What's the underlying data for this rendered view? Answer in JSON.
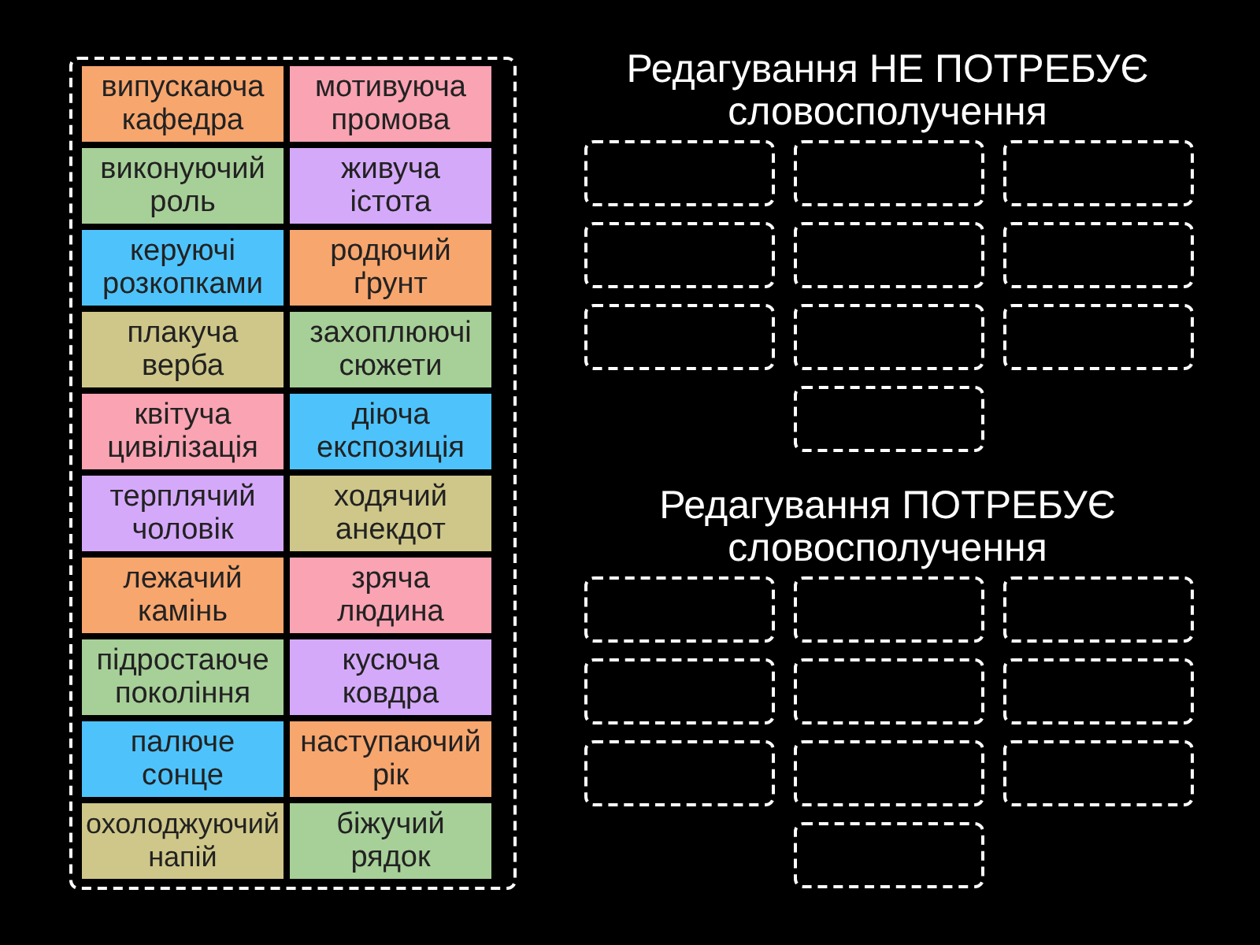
{
  "tiles": [
    {
      "text": "випускаюча кафедра",
      "color": "#f7a66e"
    },
    {
      "text": "мотивуюча промова",
      "color": "#f9a3b3"
    },
    {
      "text": "виконуючий роль",
      "color": "#a7cf98"
    },
    {
      "text": "живуча істота",
      "color": "#d5a9fa"
    },
    {
      "text": "керуючі розкопками",
      "color": "#4ec3fb"
    },
    {
      "text": "родючий ґрунт",
      "color": "#f7a66e"
    },
    {
      "text": "плакуча верба",
      "color": "#cfc789"
    },
    {
      "text": "захоплюючі сюжети",
      "color": "#a7cf98"
    },
    {
      "text": "квітуча цивілізація",
      "color": "#f9a3b3"
    },
    {
      "text": "діюча експозиція",
      "color": "#4ec3fb"
    },
    {
      "text": "терплячий чоловік",
      "color": "#d5a9fa"
    },
    {
      "text": "ходячий анекдот",
      "color": "#cfc789"
    },
    {
      "text": "лежачий камінь",
      "color": "#f7a66e"
    },
    {
      "text": "зряча людина",
      "color": "#f9a3b3"
    },
    {
      "text": "підростаюче покоління",
      "color": "#a7cf98"
    },
    {
      "text": "кусюча ковдра",
      "color": "#d5a9fa"
    },
    {
      "text": "палюче сонце",
      "color": "#4ec3fb"
    },
    {
      "text": "наступаючий рік",
      "color": "#f7a66e"
    },
    {
      "text": "охолоджуючий напій",
      "color": "#cfc789"
    },
    {
      "text": "біжучий рядок",
      "color": "#a7cf98"
    }
  ],
  "groups": [
    {
      "title": "Редагування НЕ ПОТРЕБУЄ словосполучення",
      "slots": [
        {
          "filled": false
        },
        {
          "filled": false
        },
        {
          "filled": false
        },
        {
          "filled": false
        },
        {
          "filled": false
        },
        {
          "filled": false
        },
        {
          "filled": false
        },
        {
          "filled": false
        },
        {
          "filled": false
        },
        {
          "filled": false
        }
      ]
    },
    {
      "title": "Редагування ПОТРЕБУЄ словосполучення",
      "slots": [
        {
          "filled": false
        },
        {
          "filled": false
        },
        {
          "filled": false
        },
        {
          "filled": false
        },
        {
          "filled": false
        },
        {
          "filled": false
        },
        {
          "filled": false
        },
        {
          "filled": false
        },
        {
          "filled": false
        },
        {
          "filled": false
        }
      ]
    }
  ]
}
